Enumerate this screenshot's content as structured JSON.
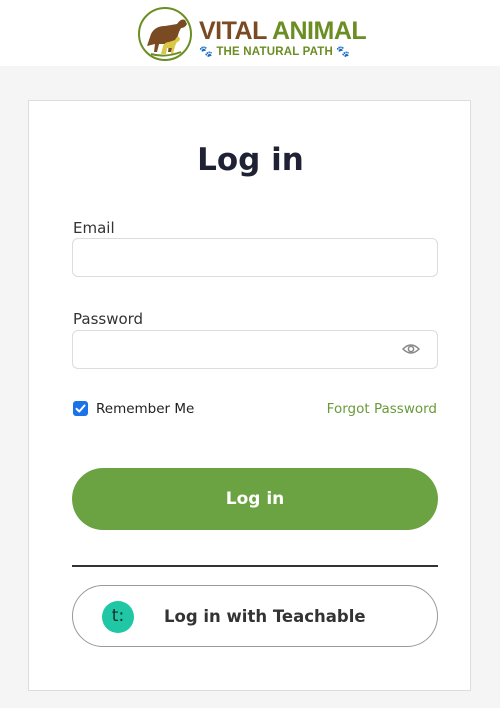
{
  "brand": {
    "name_part1": "VITAL ",
    "name_part2": "ANIMAL",
    "tagline": "THE NATURAL PATH",
    "paw": "🐾"
  },
  "login": {
    "title": "Log in",
    "email_label": "Email",
    "email_value": "",
    "password_label": "Password",
    "password_value": "",
    "remember_label": "Remember Me",
    "remember_checked": true,
    "forgot_label": "Forgot Password",
    "submit_label": "Log in"
  },
  "sso": {
    "icon_glyph": "t:",
    "label": "Log in with Teachable"
  },
  "colors": {
    "primary": "#6ba342",
    "link": "#6a9a3a",
    "teachable": "#1fc7a4",
    "checkbox": "#1a73e8"
  },
  "icons": [
    "eye-icon",
    "check-icon",
    "teachable-logo-icon"
  ]
}
